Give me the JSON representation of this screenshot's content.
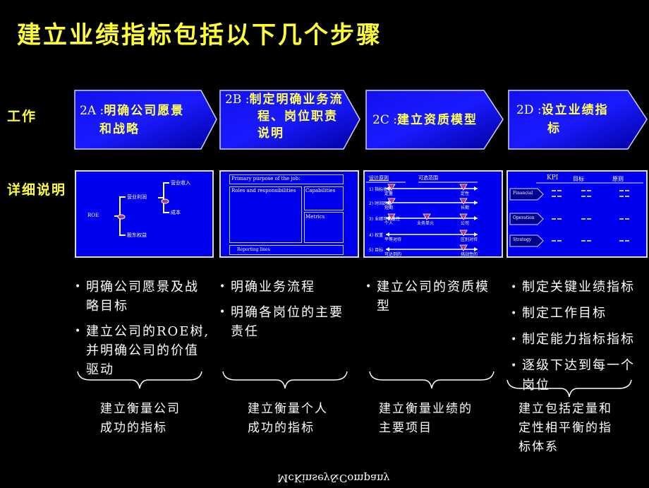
{
  "title": "建立业绩指标包括以下几个步骤",
  "row_labels": {
    "work": "工作",
    "details": "详细说明"
  },
  "steps": [
    {
      "code": "2A :",
      "line1": "明确公司愿景",
      "line2": "和战略"
    },
    {
      "code": "2B :",
      "line1": "制定明确业务流",
      "line2": "程、岗位职责",
      "line3": "说明"
    },
    {
      "code": "2C :",
      "line1": "建立资质模型"
    },
    {
      "code": "2D :",
      "line1": "设立业绩指",
      "line2": "标"
    }
  ],
  "details": {
    "roe_tree": {
      "root": "ROE",
      "branch_top": "营业利润",
      "branch_bottom": "股东权益",
      "sub_top": "营业收入",
      "sub_bottom": "成本"
    },
    "job_template": {
      "primary": "Primary purpose of the job:",
      "roles": "Roles and responsibilities",
      "capabilities": "Capabilities",
      "metrics": "Metrics",
      "reporting": "Reporting lines"
    },
    "competency": {
      "header_left": "设计原则",
      "header_right": "可选范围",
      "rows": [
        {
          "label": "1) 指标类型",
          "ends": [
            "定量",
            "定性"
          ]
        },
        {
          "label": "2) 时间跨度",
          "ends": [
            "短期",
            "长期"
          ]
        },
        {
          "label": "3) 业绩可衡量性",
          "ends": [
            "个人",
            "业务单元",
            "公司"
          ]
        },
        {
          "label": "4) 权重",
          "ends": [
            "平等对待",
            "区别对待"
          ]
        },
        {
          "label": "5) 目标",
          "ends": [
            "可达到的",
            "挑战性的"
          ]
        }
      ]
    },
    "kpi_table": {
      "headers": [
        "KPI",
        "目标",
        "原则"
      ],
      "rows": [
        "Financial",
        "Operation",
        "Strategy"
      ]
    }
  },
  "bullets": [
    [
      "明确公司愿景及战略目标",
      "建立公司的ROE树,并明确公司的价值驱动"
    ],
    [
      "明确业务流程",
      "明确各岗位的主要责任"
    ],
    [
      "建立公司的资质模型"
    ],
    [
      "制定关键业绩指标",
      "制定工作目标",
      "制定能力指标指标",
      "逐级下达到每一个岗位"
    ]
  ],
  "results": [
    {
      "line1": "建立衡量公司",
      "line2": "成功的指标"
    },
    {
      "line1": "建立衡量个人",
      "line2": "成功的指标"
    },
    {
      "line1": "建立衡量业绩的",
      "line2": "主要项目"
    },
    {
      "line1": "建立包括定量和",
      "line2": "定性相平衡的指",
      "line3": "标体系"
    }
  ],
  "footer": {
    "logo": "McKinsey&Company"
  },
  "colors": {
    "title": "#ffff33",
    "box_blue": "#0000f0",
    "chevron_dark": "#000090",
    "chevron_light": "#1010ff"
  }
}
